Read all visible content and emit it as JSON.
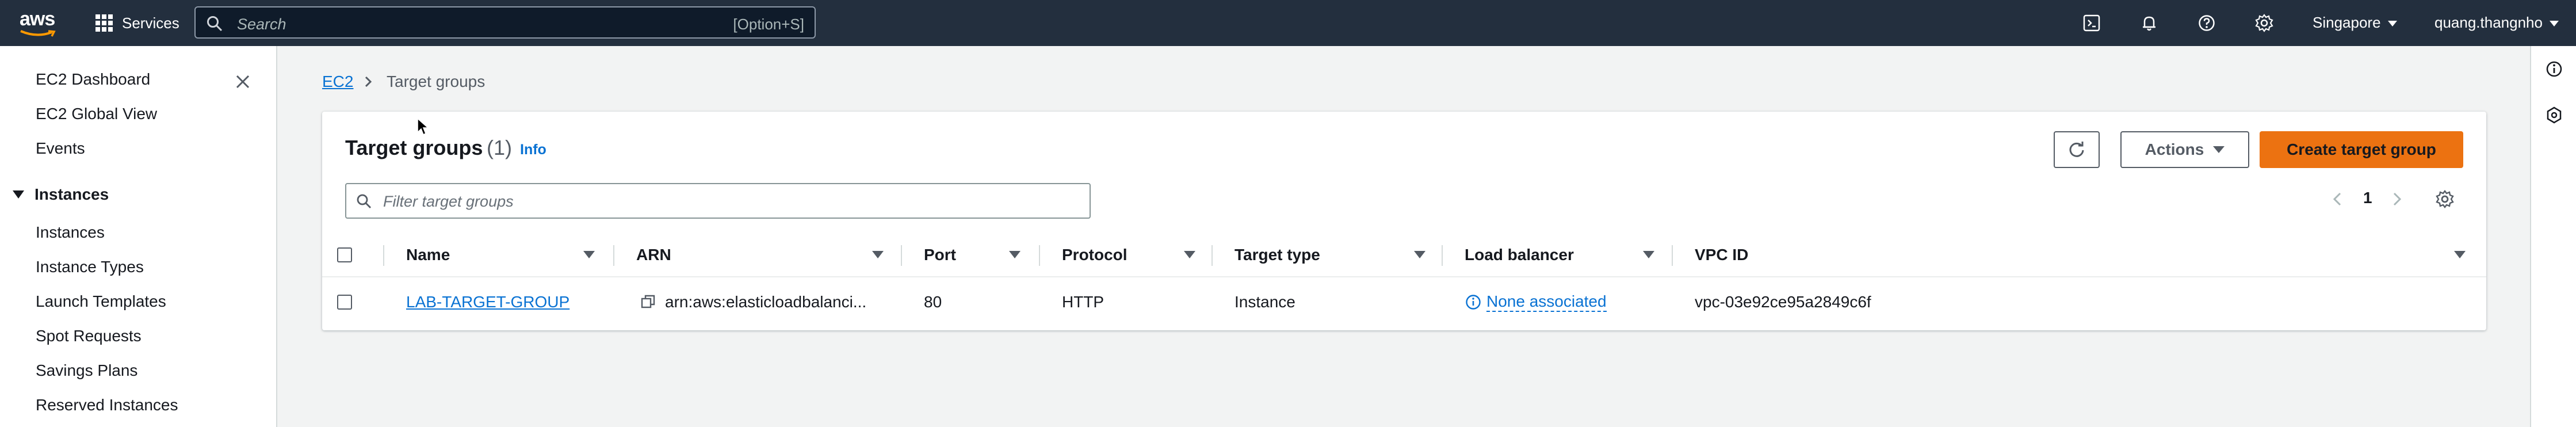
{
  "topnav": {
    "logo_text": "aws",
    "services_label": "Services",
    "search_placeholder": "Search",
    "search_shortcut": "[Option+S]",
    "region": "Singapore",
    "user": "quang.thangnho",
    "icons": [
      "cloudshell-icon",
      "bell-icon",
      "help-icon",
      "gear-icon"
    ]
  },
  "sidebar": {
    "top_items": [
      {
        "label": "EC2 Dashboard"
      },
      {
        "label": "EC2 Global View"
      },
      {
        "label": "Events"
      }
    ],
    "section": {
      "label": "Instances",
      "items": [
        {
          "label": "Instances"
        },
        {
          "label": "Instance Types"
        },
        {
          "label": "Launch Templates"
        },
        {
          "label": "Spot Requests"
        },
        {
          "label": "Savings Plans"
        },
        {
          "label": "Reserved Instances"
        }
      ]
    }
  },
  "breadcrumb": {
    "root": "EC2",
    "current": "Target groups"
  },
  "panel": {
    "title": "Target groups",
    "count": "(1)",
    "info": "Info",
    "actions_label": "Actions",
    "create_label": "Create target group",
    "filter_placeholder": "Filter target groups",
    "page": "1"
  },
  "table": {
    "columns": [
      "Name",
      "ARN",
      "Port",
      "Protocol",
      "Target type",
      "Load balancer",
      "VPC ID"
    ],
    "rows": [
      {
        "name": "LAB-TARGET-GROUP",
        "arn": "arn:aws:elasticloadbalanci...",
        "port": "80",
        "protocol": "HTTP",
        "target_type": "Instance",
        "load_balancer": "None associated",
        "vpc_id": "vpc-03e92ce95a2849c6f"
      }
    ]
  },
  "colors": {
    "nav_bg": "#232f3e",
    "link": "#0972d3",
    "primary": "#ec7211",
    "page_bg": "#f2f3f3"
  }
}
